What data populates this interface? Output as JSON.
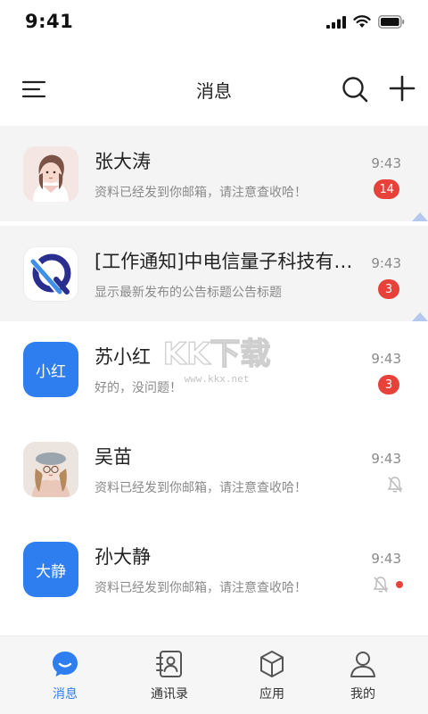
{
  "status_bar": {
    "time": "9:41"
  },
  "nav": {
    "title": "消息"
  },
  "messages": [
    {
      "name": "张大涛",
      "preview": "资料已经发到你邮箱，请注意查收哈！",
      "time": "9:43",
      "badge": "14",
      "pinned": true,
      "avatar_type": "image"
    },
    {
      "name": "[工作通知]中电信量子科技有限公司",
      "preview": "显示最新发布的公告标题公告标题",
      "time": "9:43",
      "badge": "3",
      "pinned": true,
      "avatar_type": "logo"
    },
    {
      "name": "苏小红",
      "preview": "好的，没问题！",
      "time": "9:43",
      "badge": "3",
      "pinned": false,
      "avatar_type": "text",
      "avatar_text": "小红"
    },
    {
      "name": "吴苗",
      "preview": "资料已经发到你邮箱，请注意查收哈！",
      "time": "9:43",
      "muted": true,
      "pinned": false,
      "avatar_type": "image"
    },
    {
      "name": "孙大静",
      "preview": "资料已经发到你邮箱，请注意查收哈！",
      "time": "9:43",
      "muted": true,
      "unread_dot": true,
      "pinned": false,
      "avatar_type": "text",
      "avatar_text": "大静"
    }
  ],
  "watermark": {
    "text": "KK下载",
    "url": "www.kkx.net"
  },
  "tabs": [
    {
      "label": "消息",
      "icon": "chat-bubble-icon",
      "active": true
    },
    {
      "label": "通讯录",
      "icon": "contacts-book-icon",
      "active": false
    },
    {
      "label": "应用",
      "icon": "cube-icon",
      "active": false
    },
    {
      "label": "我的",
      "icon": "person-icon",
      "active": false
    }
  ],
  "colors": {
    "accent": "#2f7ef0",
    "badge": "#e8413a",
    "pinned_bg": "#f4f4f4",
    "tab_bar_bg": "#f6f6f6"
  }
}
